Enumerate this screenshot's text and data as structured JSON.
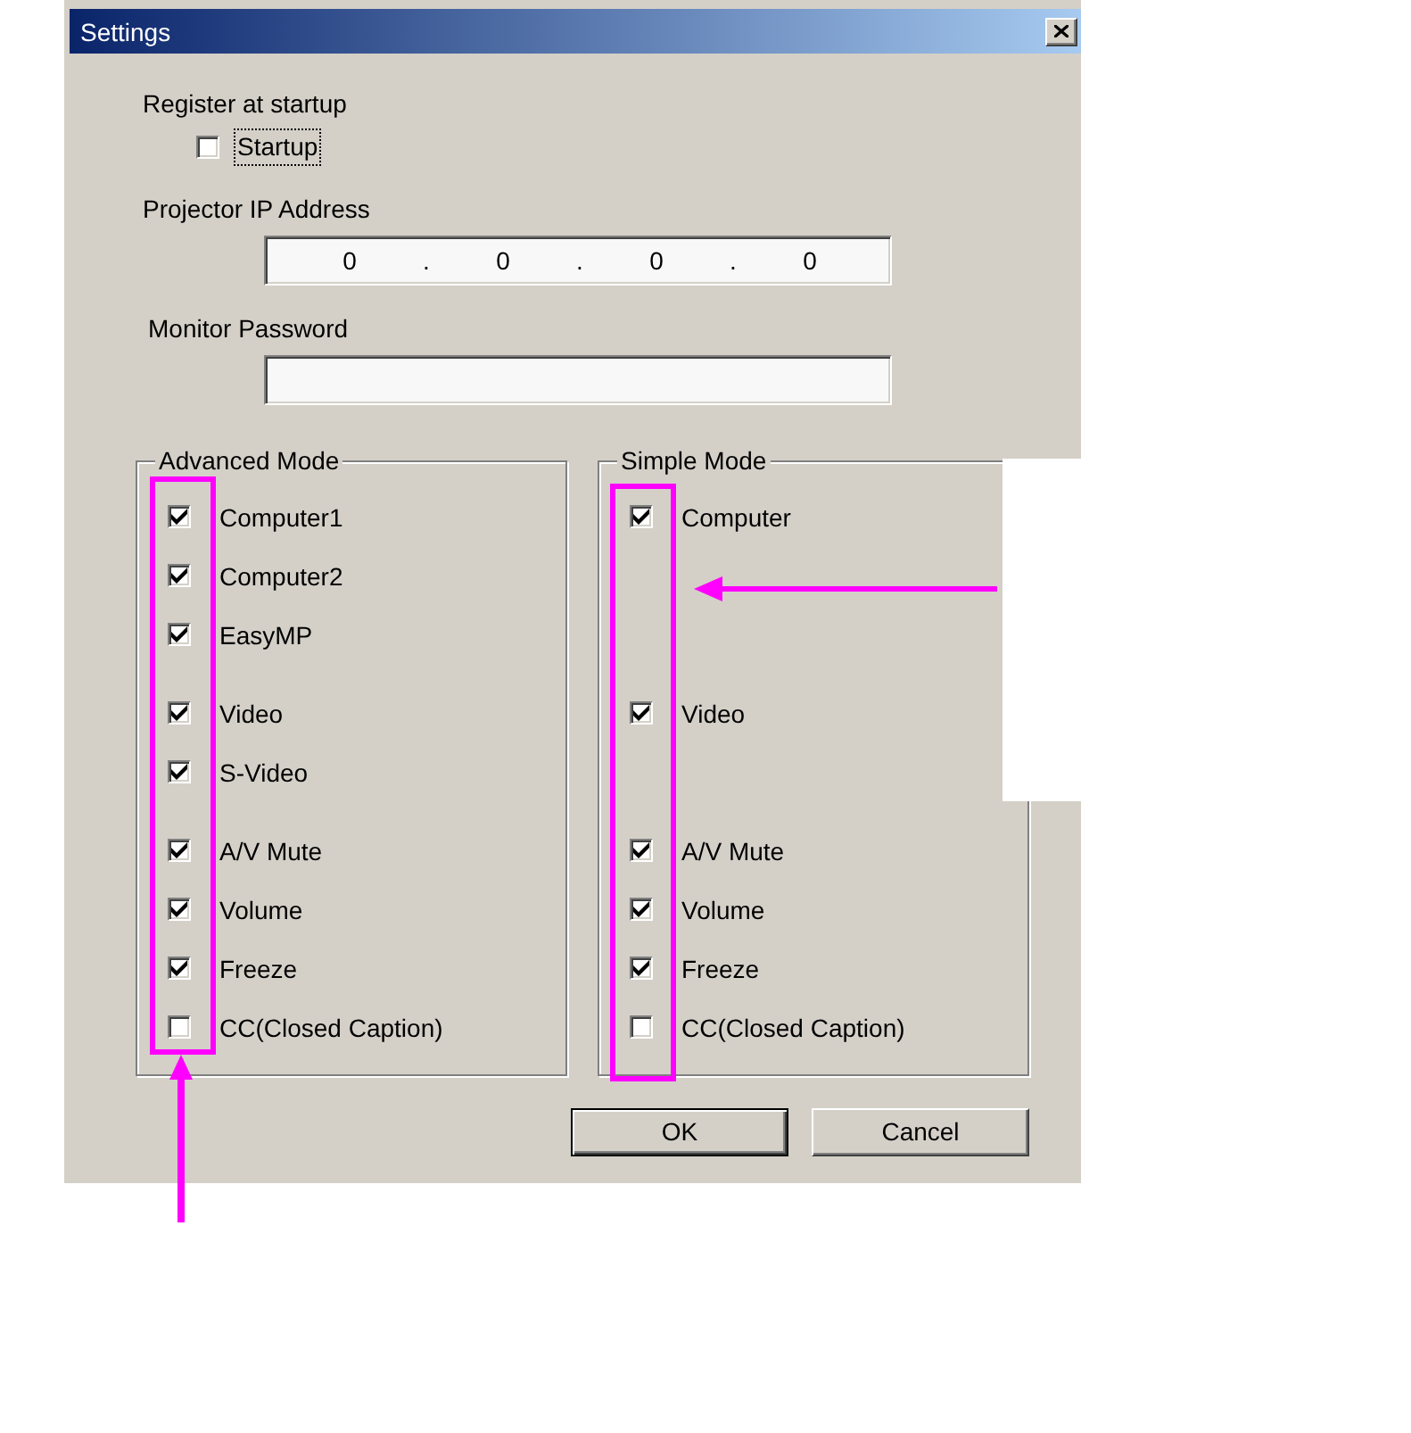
{
  "window": {
    "title": "Settings"
  },
  "startup": {
    "heading": "Register at startup",
    "label": "Startup",
    "checked": false,
    "focused": true
  },
  "ip_address": {
    "label": "Projector IP Address",
    "octets": [
      "0",
      "0",
      "0",
      "0"
    ],
    "separators": [
      ".",
      ".",
      "."
    ]
  },
  "password": {
    "label": "Monitor Password"
  },
  "groups": [
    {
      "title": "Advanced Mode",
      "sections": [
        {
          "items": [
            {
              "label": "Computer1",
              "checked": true
            },
            {
              "label": "Computer2",
              "checked": true
            },
            {
              "label": "EasyMP",
              "checked": true
            }
          ]
        },
        {
          "items": [
            {
              "label": "Video",
              "checked": true
            },
            {
              "label": "S-Video",
              "checked": true
            }
          ]
        },
        {
          "items": [
            {
              "label": "A/V Mute",
              "checked": true
            },
            {
              "label": "Volume",
              "checked": true
            },
            {
              "label": "Freeze",
              "checked": true
            },
            {
              "label": "CC(Closed Caption)",
              "checked": false
            }
          ]
        }
      ]
    },
    {
      "title": "Simple Mode",
      "sections": [
        {
          "items": [
            {
              "label": "Computer",
              "checked": true
            }
          ]
        },
        {
          "items": [
            {
              "label": "Video",
              "checked": true
            }
          ]
        },
        {
          "items": [
            {
              "label": "A/V Mute",
              "checked": true
            },
            {
              "label": "Volume",
              "checked": true
            },
            {
              "label": "Freeze",
              "checked": true
            },
            {
              "label": "CC(Closed Caption)",
              "checked": false
            }
          ]
        }
      ]
    }
  ],
  "buttons": [
    {
      "label": "OK",
      "default": true
    },
    {
      "label": "Cancel",
      "default": false
    }
  ]
}
